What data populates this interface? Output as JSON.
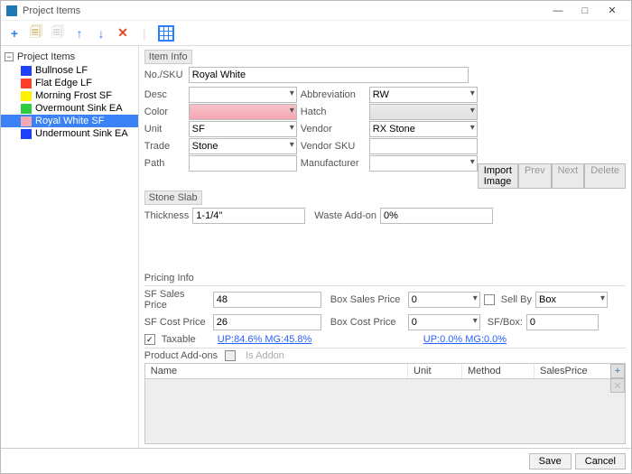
{
  "window": {
    "title": "Project Items"
  },
  "toolbar": {
    "icons": [
      "plus",
      "dup1",
      "dup2",
      "up",
      "down",
      "del",
      "grid"
    ]
  },
  "tree": {
    "root": "Project Items",
    "items": [
      {
        "label": "Bullnose  LF",
        "swatch": "sw-blue"
      },
      {
        "label": "Flat Edge  LF",
        "swatch": "sw-red"
      },
      {
        "label": "Morning Frost  SF",
        "swatch": "sw-yellow"
      },
      {
        "label": "Overmount Sink  EA",
        "swatch": "sw-green"
      },
      {
        "label": "Royal White  SF",
        "swatch": "sw-pink",
        "selected": true
      },
      {
        "label": "Undermount Sink  EA",
        "swatch": "sw-blue"
      }
    ]
  },
  "item_info": {
    "header": "Item Info",
    "no_sku_label": "No./SKU",
    "no_sku": "Royal White",
    "desc_label": "Desc",
    "desc": "",
    "abbrev_label": "Abbreviation",
    "abbrev": "RW",
    "color_label": "Color",
    "color": "",
    "hatch_label": "Hatch",
    "hatch": "",
    "unit_label": "Unit",
    "unit": "SF",
    "vendor_label": "Vendor",
    "vendor": "RX Stone",
    "trade_label": "Trade",
    "trade": "Stone",
    "vendor_sku_label": "Vendor SKU",
    "vendor_sku": "",
    "path_label": "Path",
    "path": "",
    "manufacturer_label": "Manufacturer",
    "manufacturer": "",
    "import_image": "Import Image",
    "prev": "Prev",
    "next": "Next",
    "delete": "Delete"
  },
  "slab": {
    "header": "Stone Slab",
    "thickness_label": "Thickness",
    "thickness": "1-1/4\"",
    "waste_label": "Waste Add-on",
    "waste": "0%"
  },
  "pricing": {
    "header": "Pricing Info",
    "sf_sales_label": "SF Sales Price",
    "sf_sales": "48",
    "box_sales_label": "Box Sales Price",
    "box_sales": "0",
    "sell_by_label": "Sell By",
    "sell_by": "Box",
    "sf_cost_label": "SF Cost Price",
    "sf_cost": "26",
    "box_cost_label": "Box Cost Price",
    "box_cost": "0",
    "sf_box_label": "SF/Box:",
    "sf_box": "0",
    "taxable_label": "Taxable",
    "up_link": "UP:84.6% MG:45.8%",
    "box_link": "UP:0.0% MG:0.0%"
  },
  "addons": {
    "header": "Product Add-ons",
    "is_addon": "Is Addon",
    "cols": {
      "name": "Name",
      "unit": "Unit",
      "method": "Method",
      "price": "SalesPrice"
    }
  },
  "footer": {
    "save": "Save",
    "cancel": "Cancel"
  }
}
